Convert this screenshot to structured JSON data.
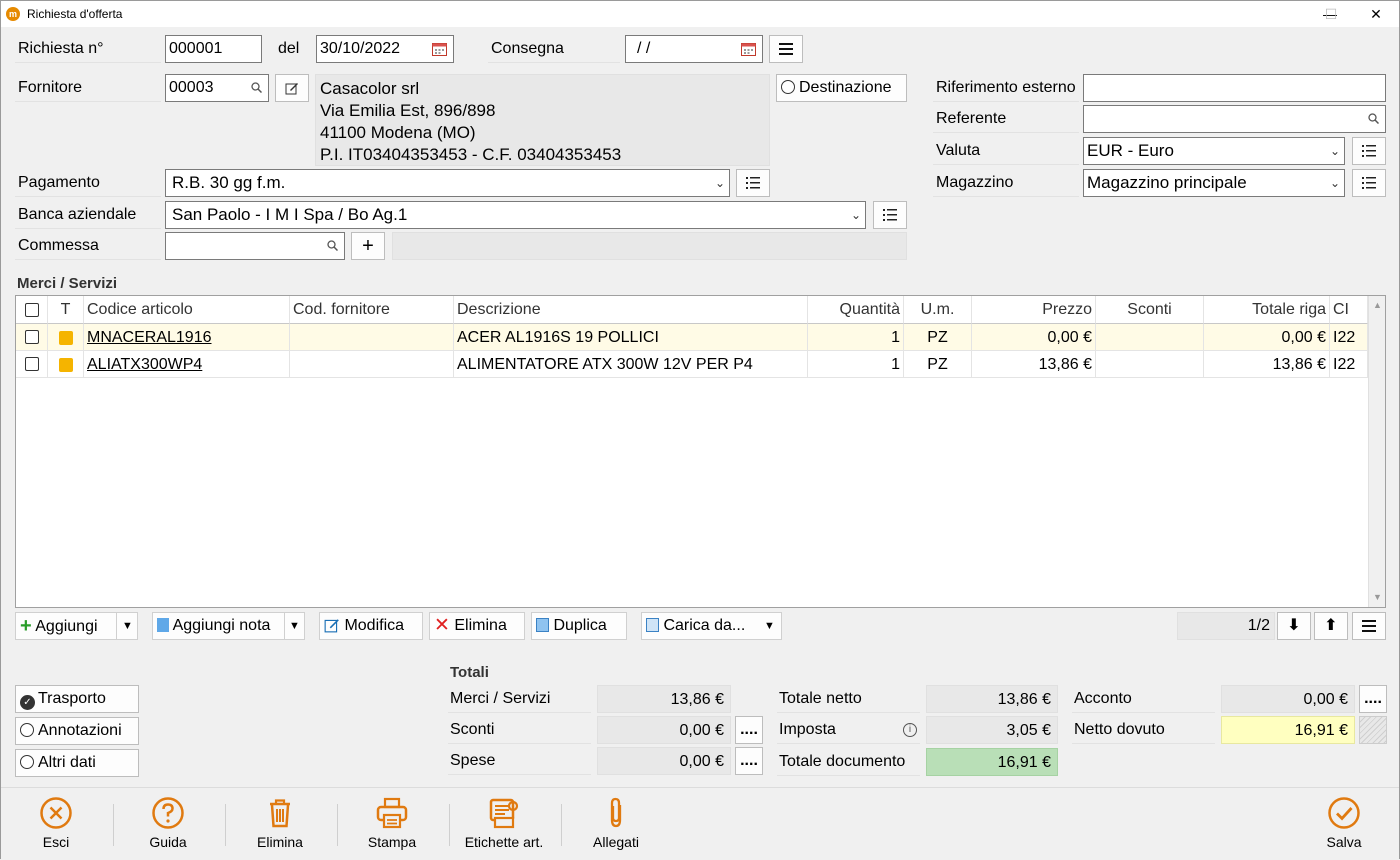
{
  "window": {
    "title": "Richiesta d'offerta",
    "minimize": "—",
    "maximize": "☐",
    "close": "✕"
  },
  "header": {
    "numero_label": "Richiesta n°",
    "numero": "000001",
    "del_label": "del",
    "data": "30/10/2022",
    "consegna_label": "Consegna",
    "consegna": " /  /",
    "fornitore_label": "Fornitore",
    "fornitore": "00003",
    "fornitore_ragione": "Casacolor srl",
    "fornitore_indirizzo": "Via Emilia Est, 896/898",
    "fornitore_citta": "41100 Modena (MO)",
    "fornitore_piva": "P.I. IT03404353453 - C.F. 03404353453",
    "destinazione_label": "Destinazione",
    "rif_esterno_label": "Riferimento esterno",
    "rif_esterno": "",
    "referente_label": "Referente",
    "referente": "",
    "valuta_label": "Valuta",
    "valuta": "EUR - Euro",
    "magazzino_label": "Magazzino",
    "magazzino": "Magazzino principale",
    "pagamento_label": "Pagamento",
    "pagamento": "R.B. 30 gg f.m.",
    "banca_label": "Banca aziendale",
    "banca": "San Paolo - I M I Spa / Bo Ag.1",
    "commessa_label": "Commessa",
    "commessa": "",
    "commessa_add": "+"
  },
  "grid": {
    "section_title": "Merci / Servizi",
    "columns": [
      "T",
      "Codice articolo",
      "Cod. fornitore",
      "Descrizione",
      "Quantità",
      "U.m.",
      "Prezzo",
      "Sconti",
      "Totale riga",
      "CI"
    ],
    "rows": [
      {
        "codice": "MNACERAL1916",
        "cod_fornitore": "",
        "descrizione": "ACER AL1916S 19 POLLICI",
        "quantita": "1",
        "um": "PZ",
        "prezzo": "0,00 €",
        "sconti": "",
        "totale": "0,00 €",
        "ci": "I22"
      },
      {
        "codice": "ALIATX300WP4",
        "cod_fornitore": "",
        "descrizione": "ALIMENTATORE ATX 300W 12V PER  P4",
        "quantita": "1",
        "um": "PZ",
        "prezzo": "13,86 €",
        "sconti": "",
        "totale": "13,86 €",
        "ci": "I22"
      }
    ]
  },
  "toolbar": {
    "aggiungi": "Aggiungi",
    "aggiungi_nota": "Aggiungi nota",
    "modifica": "Modifica",
    "elimina": "Elimina",
    "duplica": "Duplica",
    "carica_da": "Carica da...",
    "pagina": "1/2"
  },
  "options": {
    "trasporto": "Trasporto",
    "annotazioni": "Annotazioni",
    "altri_dati": "Altri dati"
  },
  "totali": {
    "title": "Totali",
    "merci_label": "Merci / Servizi",
    "merci": "13,86 €",
    "sconti_label": "Sconti",
    "sconti": "0,00 €",
    "spese_label": "Spese",
    "spese": "0,00 €",
    "netto_label": "Totale netto",
    "netto": "13,86 €",
    "imposta_label": "Imposta",
    "imposta": "3,05 €",
    "documento_label": "Totale documento",
    "documento": "16,91 €",
    "acconto_label": "Acconto",
    "acconto": "0,00 €",
    "dovuto_label": "Netto dovuto",
    "dovuto": "16,91 €",
    "ellipsis": "...."
  },
  "footer": {
    "esci": "Esci",
    "guida": "Guida",
    "elimina": "Elimina",
    "stampa": "Stampa",
    "etichette": "Etichette art.",
    "allegati": "Allegati",
    "salva": "Salva"
  },
  "colors": {
    "accent": "#e07a10",
    "highlight_row": "#fffbe6",
    "totale_doc": "#b9dfb7",
    "netto_dovuto": "#ffffc0"
  }
}
